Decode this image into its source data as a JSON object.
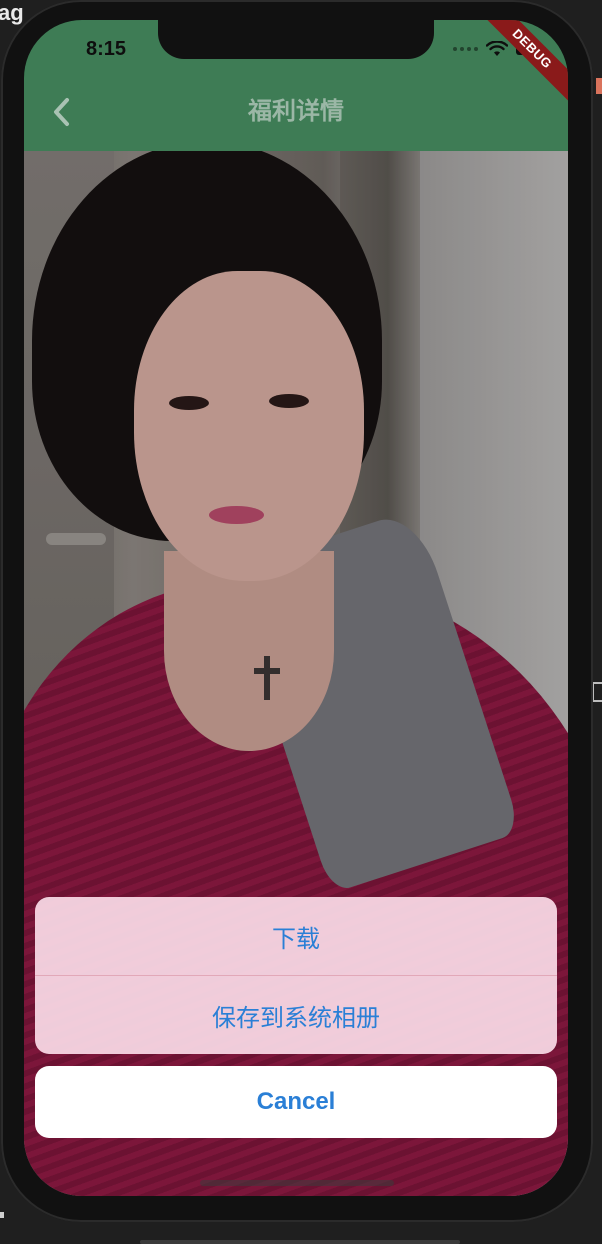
{
  "desktop": {
    "corner_text": "ag"
  },
  "status_bar": {
    "time": "8:15",
    "debug_label": "DEBUG",
    "wifi_icon": "wifi-icon",
    "battery_icon": "battery-icon"
  },
  "app_bar": {
    "title": "福利详情",
    "back_icon": "chevron-left-icon",
    "color": "#3e7c55"
  },
  "action_sheet": {
    "items": [
      {
        "label": "下载"
      },
      {
        "label": "保存到系统相册"
      }
    ],
    "cancel_label": "Cancel",
    "accent_color": "#2a7fd6"
  }
}
